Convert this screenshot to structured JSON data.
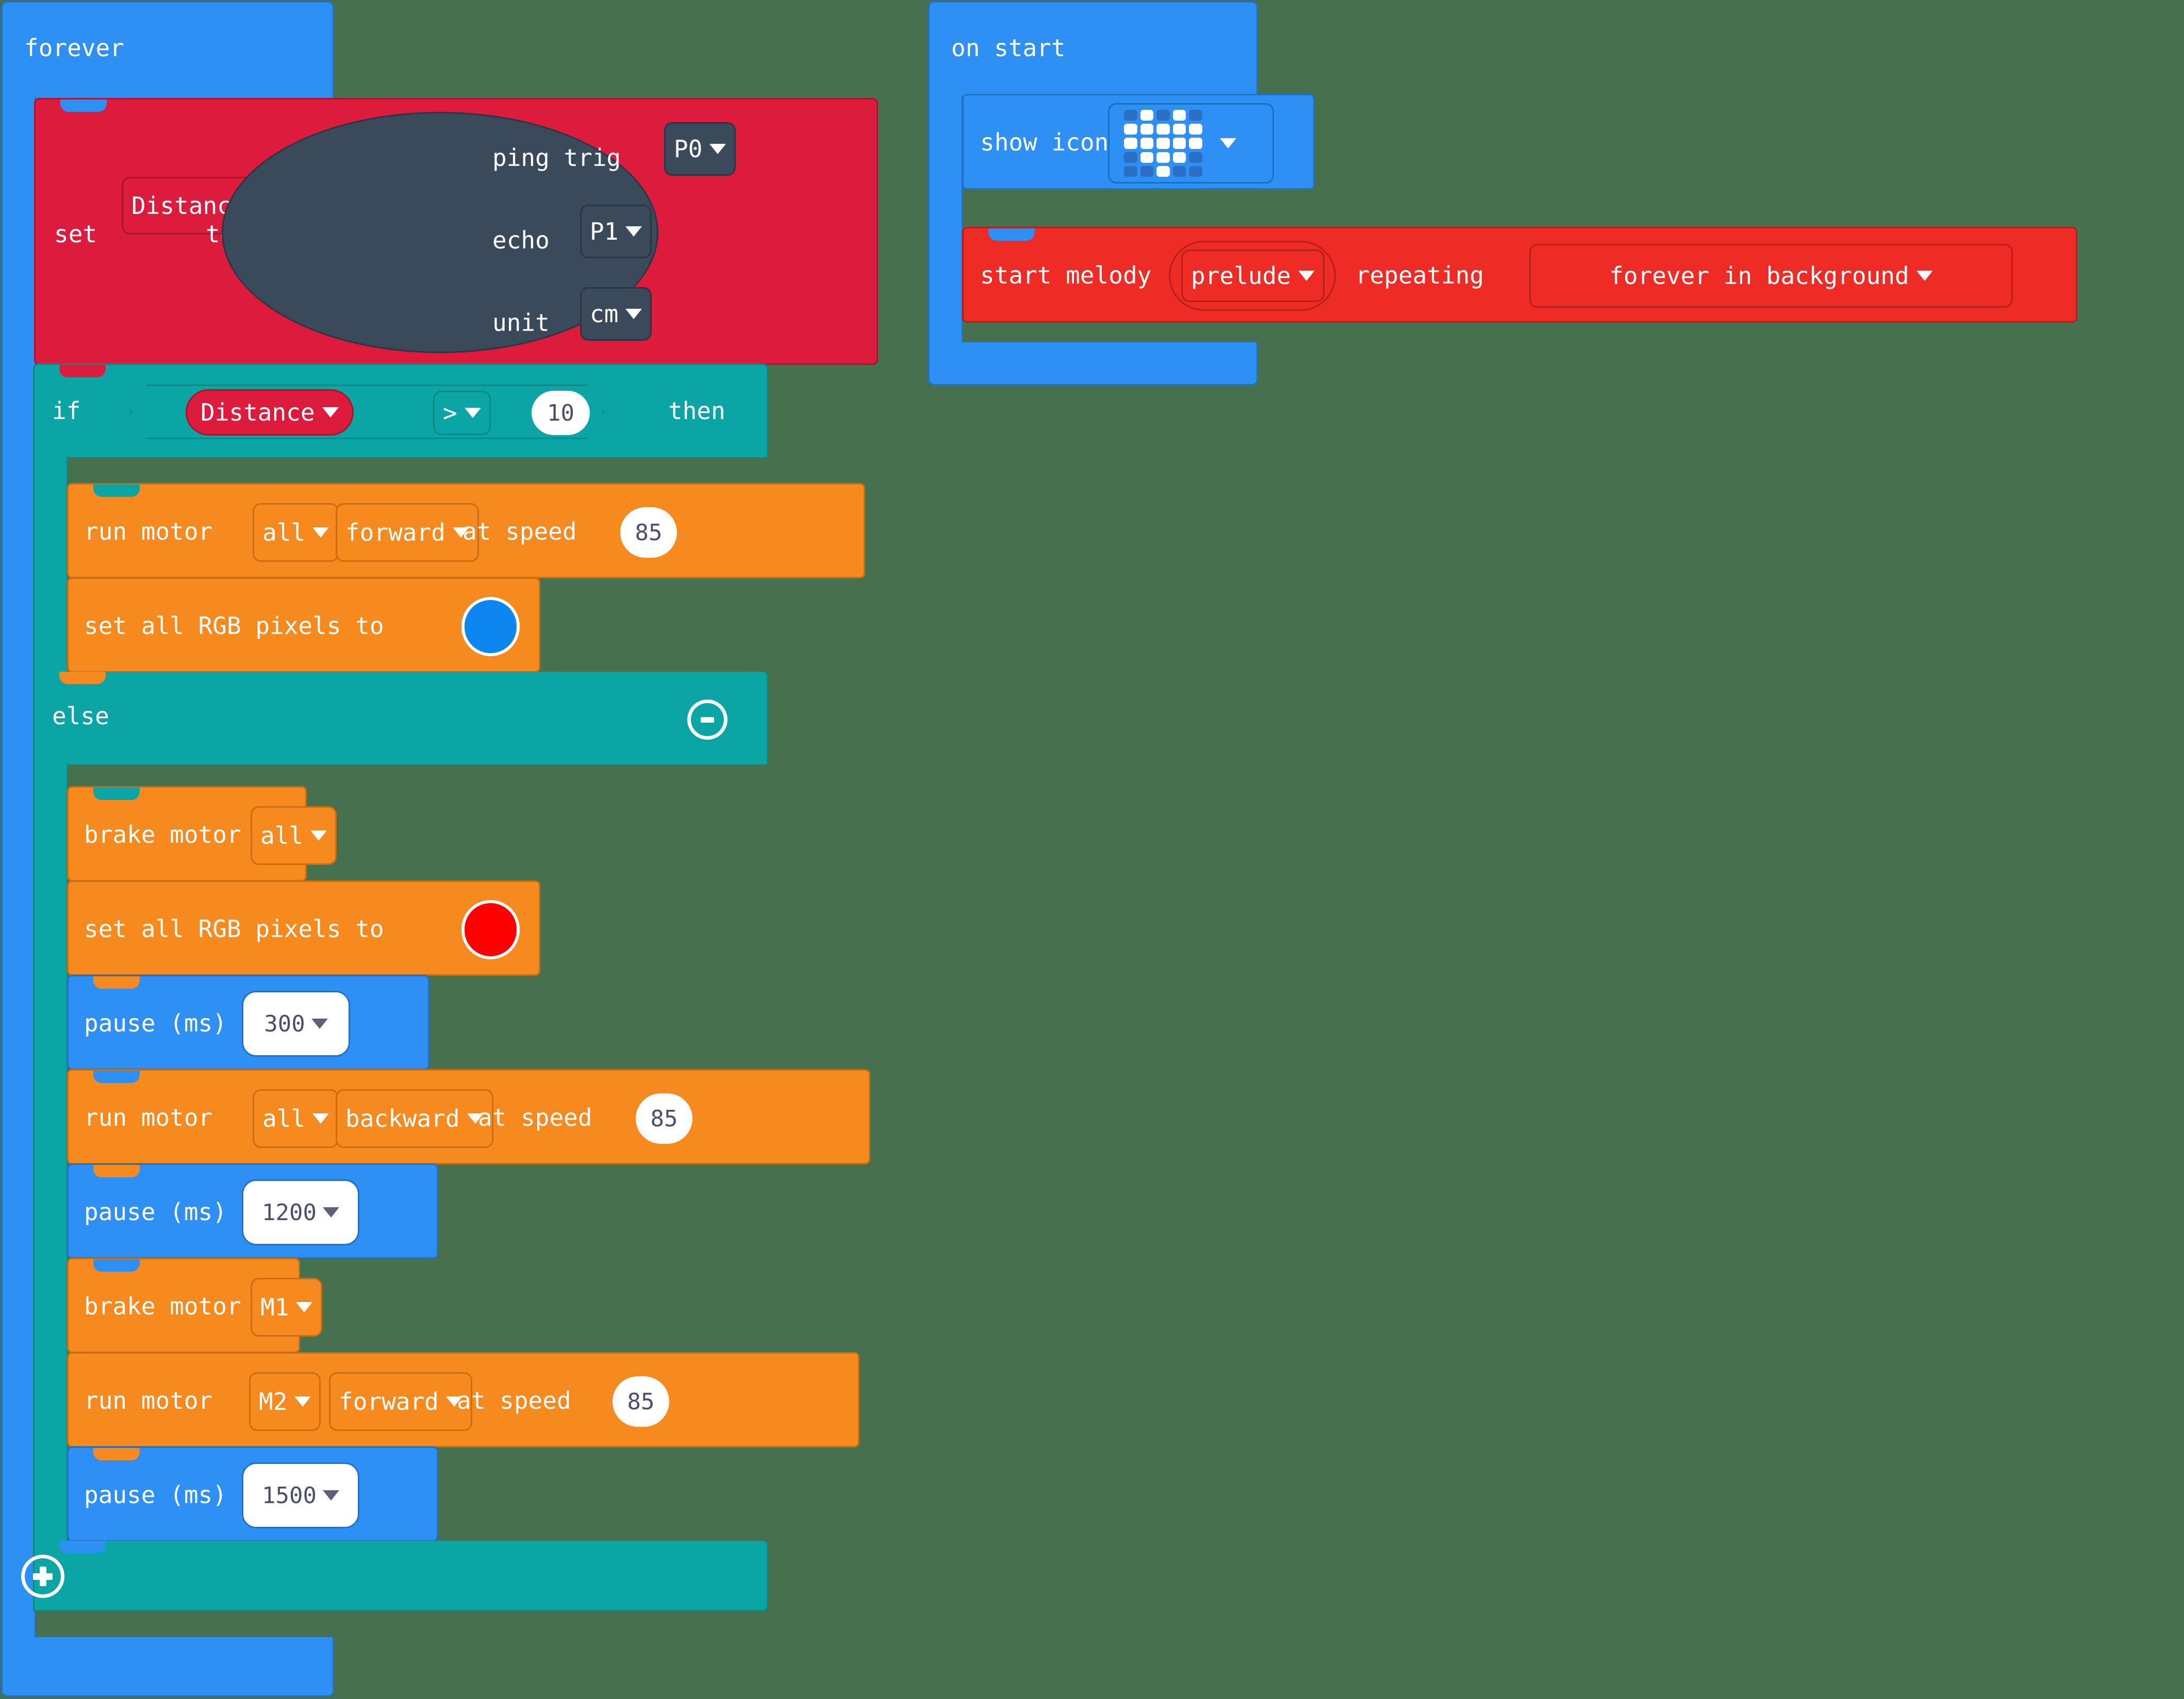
{
  "editor": {
    "name": "microsoft-makecode-blocks-workspace",
    "background_color": "#47704E"
  },
  "palette": {
    "loops_blue": "#2E8FF4",
    "variables_red": "#DD1B3C",
    "logic_teal": "#0CA5A5",
    "motor_orange": "#F68A1F",
    "music_red": "#EE2B25",
    "sonar_dark": "#3B4A5A"
  },
  "scripts": {
    "forever": {
      "header_label": "forever",
      "set_variable": {
        "set_label": "set",
        "variable_name": "Distance",
        "to_label": "to",
        "sonar": {
          "ping_trig_label": "ping trig",
          "ping_trig_value": "P0",
          "echo_label": "echo",
          "echo_value": "P1",
          "unit_label": "unit",
          "unit_value": "cm"
        }
      },
      "conditional": {
        "if_label": "if",
        "then_label": "then",
        "else_label": "else",
        "condition": {
          "left_variable": "Distance",
          "operator": ">",
          "right_value": "10"
        },
        "then_branch": [
          {
            "type": "run-motor",
            "prefix_label": "run motor",
            "motor": "all",
            "direction": "forward",
            "speed_label": "at speed",
            "speed_value": "85"
          },
          {
            "type": "set-rgb-pixels",
            "label": "set all RGB pixels to",
            "color": "#0D86EF"
          }
        ],
        "else_branch": [
          {
            "type": "brake-motor",
            "prefix_label": "brake motor",
            "motor": "all"
          },
          {
            "type": "set-rgb-pixels",
            "label": "set all RGB pixels to",
            "color": "#FF0000"
          },
          {
            "type": "pause",
            "label": "pause (ms)",
            "value": "300"
          },
          {
            "type": "run-motor",
            "prefix_label": "run motor",
            "motor": "all",
            "direction": "backward",
            "speed_label": "at speed",
            "speed_value": "85"
          },
          {
            "type": "pause",
            "label": "pause (ms)",
            "value": "1200"
          },
          {
            "type": "brake-motor",
            "prefix_label": "brake motor",
            "motor": "M1"
          },
          {
            "type": "run-motor",
            "prefix_label": "run motor",
            "motor": "M2",
            "direction": "forward",
            "speed_label": "at speed",
            "speed_value": "85"
          },
          {
            "type": "pause",
            "label": "pause (ms)",
            "value": "1500"
          }
        ],
        "collapse_button_icon": "minus-circle-icon",
        "expand_button_icon": "plus-circle-icon"
      }
    },
    "on_start": {
      "header_label": "on start",
      "show_icon": {
        "label": "show icon",
        "icon_name": "heart-icon",
        "matrix": [
          [
            0,
            1,
            0,
            1,
            0
          ],
          [
            1,
            1,
            1,
            1,
            1
          ],
          [
            1,
            1,
            1,
            1,
            1
          ],
          [
            0,
            1,
            1,
            1,
            0
          ],
          [
            0,
            0,
            1,
            0,
            0
          ]
        ]
      },
      "start_melody": {
        "prefix_label": "start melody",
        "melody": "prelude",
        "repeating_label": "repeating",
        "repeat_mode": "forever in background"
      }
    }
  }
}
